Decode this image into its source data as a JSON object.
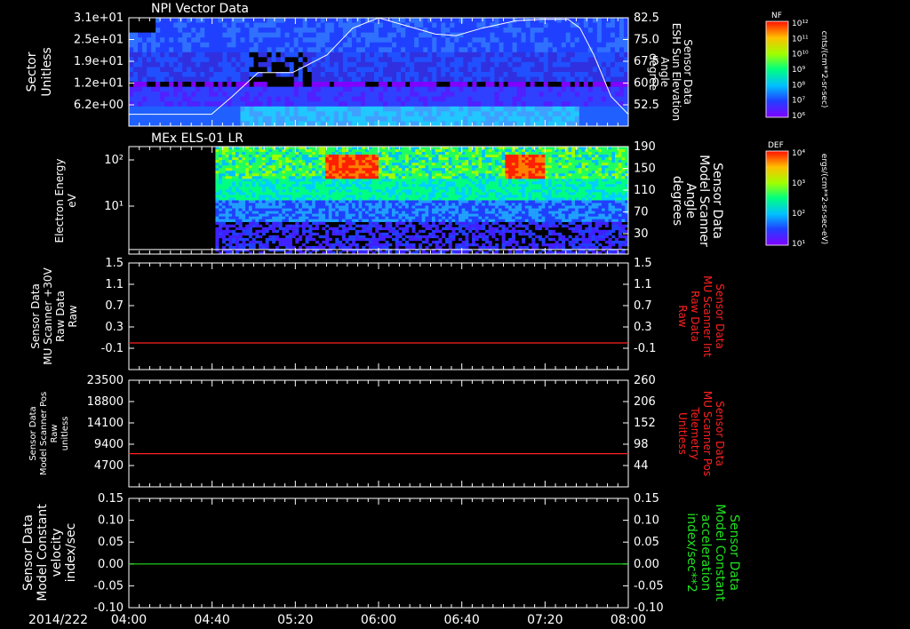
{
  "chart_data": [
    {
      "type": "heatmap",
      "title": "NPI Vector Data",
      "left_axis": {
        "label_lines": [
          "Sector",
          "Unitless"
        ],
        "ticks": [
          "3.1e+01",
          "2.5e+01",
          "1.9e+01",
          "1.2e+01",
          "6.2e+00"
        ]
      },
      "right_axis": {
        "label_lines": [
          "Sensor Data",
          "ESH Sun Elevation",
          "Angle",
          "degree"
        ],
        "ticks": [
          "82.5",
          "75.0",
          "67.5",
          "60.0",
          "52.5"
        ],
        "range": [
          46,
          82.5
        ]
      },
      "colorbar": {
        "title": "NF",
        "unit": "cnts/(cm**2-sr-sec)",
        "ticks": [
          "10¹²",
          "10¹¹",
          "10¹⁰",
          "10⁹",
          "10⁸",
          "10⁷",
          "10⁶"
        ]
      },
      "overlay_line": {
        "t": [
          0,
          48,
          60,
          75,
          95,
          115,
          130,
          145,
          160,
          178,
          190,
          205,
          225,
          240,
          255,
          262,
          270,
          280,
          290
        ],
        "v": [
          50,
          50,
          56,
          64,
          64,
          70,
          79,
          82.5,
          80,
          77,
          76.5,
          79,
          81.5,
          82,
          82,
          79,
          70,
          56,
          50
        ]
      }
    },
    {
      "type": "heatmap",
      "title": "MEx ELS-01 LR",
      "left_axis": {
        "label_lines": [
          "Electron Energy",
          "eV"
        ],
        "ticks": [
          "10²",
          "10¹"
        ]
      },
      "right_axis": {
        "label_lines": [
          "Sensor Data",
          "Model Scanner",
          "Angle",
          "degrees"
        ],
        "ticks": [
          "190",
          "150",
          "110",
          "70",
          "30"
        ],
        "range": [
          0,
          190
        ]
      },
      "colorbar": {
        "title": "DEF",
        "unit": "ergs/(cm**2-sr-sec-eV)",
        "ticks": [
          "10⁴",
          "10³",
          "10²",
          "10¹"
        ]
      },
      "overlay_line": {
        "t": [
          0,
          290
        ],
        "v": [
          8,
          8
        ]
      }
    },
    {
      "type": "line",
      "left_axis": {
        "label_lines": [
          "Sensor Data",
          "MU Scanner +30V",
          "Raw Data",
          "Raw"
        ],
        "ticks": [
          "1.5",
          "1.1",
          "0.7",
          "0.3",
          "-0.1"
        ],
        "range": [
          -0.5,
          1.5
        ]
      },
      "right_axis": {
        "label_lines": [
          "Sensor Data",
          "MU Scanner Int",
          "Raw Data",
          "Raw"
        ],
        "ticks": [
          "1.5",
          "1.1",
          "0.7",
          "0.3",
          "-0.1"
        ],
        "range": [
          -0.5,
          1.5
        ],
        "color": "#ff2020"
      },
      "series": [
        {
          "t": [
            0,
            290
          ],
          "values": [
            0,
            0
          ],
          "color": "#ff2020"
        }
      ]
    },
    {
      "type": "line",
      "left_axis": {
        "label_lines": [
          "Sensor Data",
          "Model Scanner Pos",
          "Raw",
          "unitless"
        ],
        "ticks": [
          "23500",
          "18800",
          "14100",
          "9400",
          "4700"
        ],
        "range": [
          0,
          23500
        ]
      },
      "right_axis": {
        "label_lines": [
          "Sensor Data",
          "MU Scanner Pos",
          "Telemetry",
          "Unitless"
        ],
        "ticks": [
          "260",
          "206",
          "152",
          "98",
          "44"
        ],
        "range": [
          0,
          260
        ],
        "color": "#ff2020"
      },
      "series": [
        {
          "t": [
            0,
            290
          ],
          "values": [
            81,
            81
          ],
          "axis": "right",
          "color": "#ff2020"
        }
      ]
    },
    {
      "type": "line",
      "left_axis": {
        "label_lines": [
          "Sensor Data",
          "Model Constant",
          "velocity",
          "index/sec"
        ],
        "ticks": [
          "0.15",
          "0.10",
          "0.05",
          "0.00",
          "-0.05",
          "-0.10"
        ],
        "range": [
          -0.1,
          0.15
        ]
      },
      "right_axis": {
        "label_lines": [
          "Sensor Data",
          "Model Constant",
          "acceleration",
          "index/sec**2"
        ],
        "ticks": [
          "0.15",
          "0.10",
          "0.05",
          "0.00",
          "-0.05",
          "-0.10"
        ],
        "range": [
          -0.1,
          0.15
        ],
        "color": "#20e020"
      },
      "series": [
        {
          "t": [
            0,
            290
          ],
          "values": [
            0,
            0
          ],
          "color": "#20e020"
        }
      ]
    }
  ],
  "time_axis": {
    "date": "2014/222",
    "labels": [
      "04:00",
      "04:40",
      "05:20",
      "06:00",
      "06:40",
      "07:20",
      "08:00"
    ]
  },
  "colors": {
    "background": "#000000",
    "axis": "#ffffff",
    "red_trace": "#ff2020",
    "green_trace": "#20e020"
  }
}
